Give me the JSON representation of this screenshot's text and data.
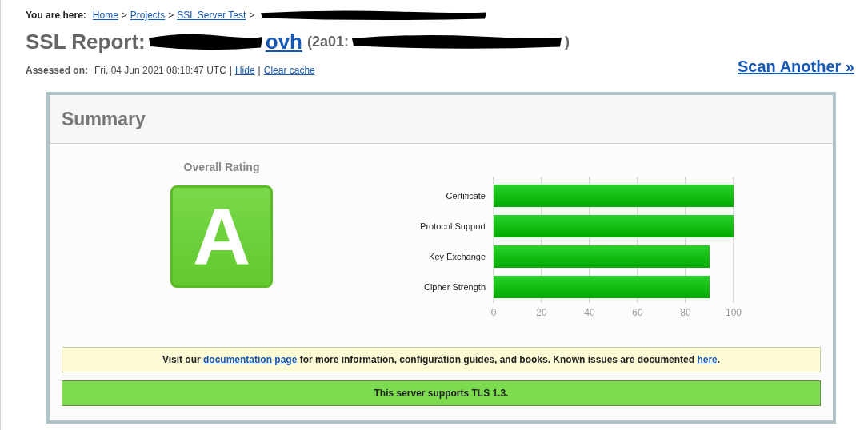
{
  "breadcrumb": {
    "label": "You are here:",
    "links": [
      "Home",
      "Projects",
      "SSL Server Test"
    ],
    "separator": ">"
  },
  "title": {
    "label": "SSL Report:",
    "host_link": "ovh",
    "address_open": "(2a01:",
    "address_close": ")"
  },
  "assessed": {
    "label": "Assessed on:",
    "date": "Fri, 04 Jun 2021 08:18:47 UTC",
    "links": [
      "Hide",
      "Clear cache"
    ],
    "separator": "|"
  },
  "scan_another": "Scan Another »",
  "summary": {
    "title": "Summary",
    "rating_label": "Overall Rating",
    "grade": "A",
    "chart_data": {
      "type": "bar",
      "orientation": "horizontal",
      "categories": [
        "Certificate",
        "Protocol Support",
        "Key Exchange",
        "Cipher Strength"
      ],
      "series": [
        {
          "color": "#1ec21e",
          "values": [
            100,
            100,
            90,
            90
          ]
        }
      ],
      "xlim": [
        0,
        100
      ],
      "xticks": [
        0,
        20,
        40,
        60,
        80,
        100
      ],
      "grid": true
    },
    "notices": [
      {
        "kind": "info",
        "parts": [
          {
            "kind": "text",
            "text": "Visit our "
          },
          {
            "kind": "link",
            "text": "documentation page"
          },
          {
            "kind": "text",
            "text": " for more information, configuration guides, and books. Known issues are documented "
          },
          {
            "kind": "link",
            "text": "here"
          },
          {
            "kind": "text",
            "text": "."
          }
        ]
      },
      {
        "kind": "good",
        "parts": [
          {
            "kind": "text",
            "text": "This server supports TLS 1.3."
          }
        ]
      }
    ]
  }
}
